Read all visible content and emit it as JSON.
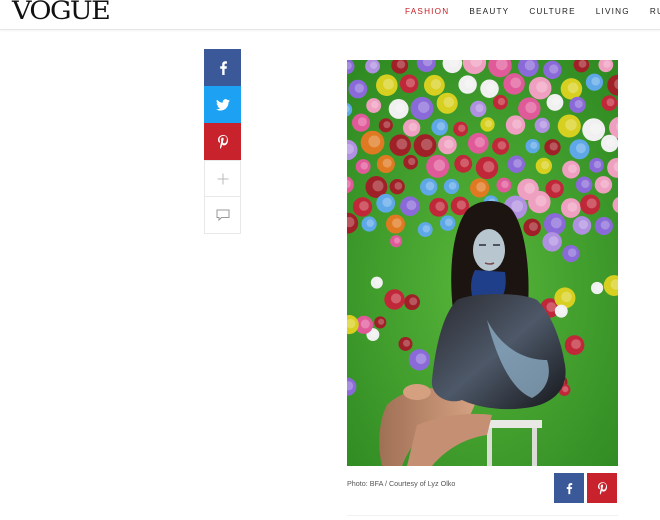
{
  "header": {
    "logo": "VOGUE",
    "nav": [
      "FASHION",
      "BEAUTY",
      "CULTURE",
      "LIVING",
      "RUNWA"
    ],
    "active_nav": "FASHION"
  },
  "share_bar": {
    "icons": [
      "facebook-icon",
      "twitter-icon",
      "pinterest-icon",
      "plus-icon",
      "comment-icon"
    ],
    "colors": {
      "facebook": "#3b5998",
      "twitter": "#1da1f2",
      "pinterest": "#c8232c"
    }
  },
  "photo": {
    "caption": "Photo: BFA / Courtesy of Lyz Olko"
  },
  "colors": {
    "brand_red": "#c41d24",
    "photo_green": "#3f9e2a"
  }
}
